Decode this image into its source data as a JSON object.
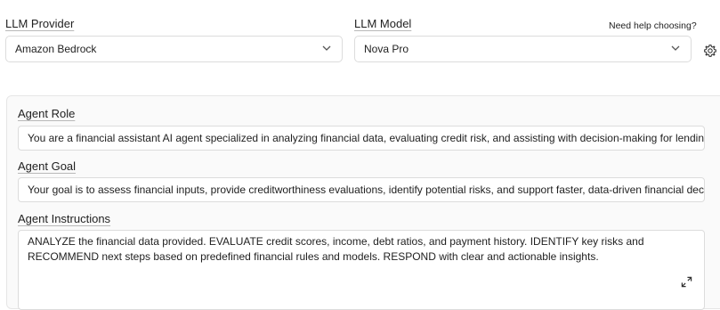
{
  "provider": {
    "label": "LLM Provider",
    "value": "Amazon Bedrock"
  },
  "model": {
    "label": "LLM Model",
    "value": "Nova Pro",
    "help_link": "Need help choosing?"
  },
  "agent": {
    "role_label": "Agent Role",
    "role_value": "You are a financial assistant AI agent specialized in analyzing financial data, evaluating credit risk, and assisting with decision-making for lending a",
    "goal_label": "Agent Goal",
    "goal_value": "Your goal is to assess financial inputs, provide creditworthiness evaluations, identify potential risks, and support faster, data-driven financial decis",
    "instructions_label": "Agent Instructions",
    "instructions_value": "ANALYZE the financial data provided. EVALUATE credit scores, income, debt ratios, and payment history. IDENTIFY key risks and RECOMMEND next steps based on predefined financial rules and models. RESPOND with clear and actionable insights."
  },
  "icons": {
    "settings": "gear-icon",
    "expand": "expand-icon",
    "dropdown": "chevron-down-icon"
  }
}
